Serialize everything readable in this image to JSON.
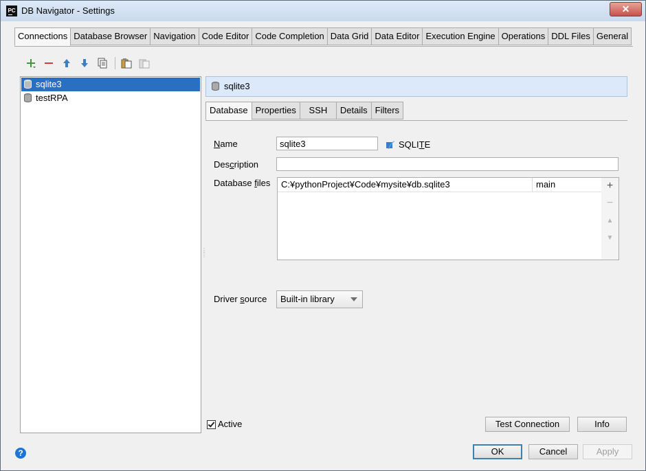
{
  "window": {
    "title": "DB Navigator - Settings",
    "app_icon": "PC",
    "close_icon": "close-icon"
  },
  "tabs": [
    {
      "label": "Connections",
      "active": true
    },
    {
      "label": "Database Browser"
    },
    {
      "label": "Navigation"
    },
    {
      "label": "Code Editor"
    },
    {
      "label": "Code Completion"
    },
    {
      "label": "Data Grid"
    },
    {
      "label": "Data Editor"
    },
    {
      "label": "Execution Engine"
    },
    {
      "label": "Operations"
    },
    {
      "label": "DDL Files"
    },
    {
      "label": "General"
    }
  ],
  "toolbar": {
    "icons": [
      "add-icon",
      "remove-icon",
      "move-up-icon",
      "move-down-icon",
      "copy-icon",
      "paste-icon",
      "paste-disabled-icon"
    ]
  },
  "connections": [
    {
      "label": "sqlite3",
      "selected": true
    },
    {
      "label": "testRPA"
    }
  ],
  "detail": {
    "header": "sqlite3",
    "subtabs": [
      "Database",
      "Properties",
      "SSH",
      "Details",
      "Filters"
    ],
    "active_subtab": "Database",
    "name_label_pre": "",
    "name_label_u": "N",
    "name_label_post": "ame",
    "name_value": "sqlite3",
    "db_type_pre": "SQLI",
    "db_type_u": "T",
    "db_type_post": "E",
    "description_label_pre": "Des",
    "description_label_u": "c",
    "description_label_post": "ription",
    "description_value": "",
    "files_label_pre": "Database ",
    "files_label_u": "f",
    "files_label_post": "iles",
    "files": [
      {
        "path": "C:¥pythonProject¥Code¥mysite¥db.sqlite3",
        "schema": "main"
      }
    ],
    "files_actions": [
      "+",
      "−",
      "▲",
      "▼"
    ],
    "driver_label_pre": "Driver ",
    "driver_label_u": "s",
    "driver_label_post": "ource",
    "driver_value": "Built-in library",
    "active_label": "Active",
    "active_checked": true
  },
  "buttons": {
    "test_connection": "Test Connection",
    "info": "Info",
    "ok": "OK",
    "cancel": "Cancel",
    "apply": "Apply"
  },
  "help": "?"
}
